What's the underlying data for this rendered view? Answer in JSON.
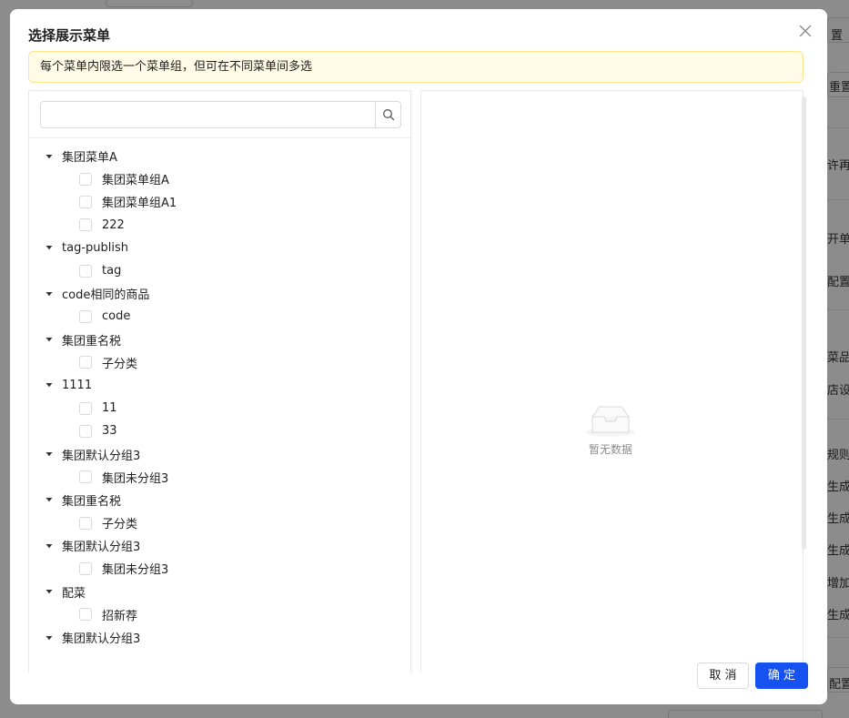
{
  "background": {
    "right_texts": [
      "置",
      "重置",
      "许再",
      "开单",
      "配置",
      "菜品",
      "店设",
      "规则",
      "生成",
      "生成",
      "生成",
      "增加",
      "生成",
      "配置"
    ],
    "bottom_texts": [
      "",
      "",
      ""
    ]
  },
  "modal": {
    "title": "选择展示菜单",
    "close_icon": "close-icon",
    "notice": "每个菜单内限选一个菜单组，但可在不同菜单间多选",
    "search": {
      "value": "",
      "placeholder": ""
    },
    "tree": [
      {
        "label": "集团菜单A",
        "children": [
          "集团菜单组A",
          "集团菜单组A1",
          "222"
        ]
      },
      {
        "label": "tag-publish",
        "children": [
          "tag"
        ]
      },
      {
        "label": "code相同的商品",
        "children": [
          "code"
        ]
      },
      {
        "label": "集团重名税",
        "children": [
          "子分类"
        ]
      },
      {
        "label": "1111",
        "children": [
          "11",
          "33"
        ]
      },
      {
        "label": "集团默认分组3",
        "children": [
          "集团未分组3"
        ]
      },
      {
        "label": "集团重名税",
        "children": [
          "子分类"
        ]
      },
      {
        "label": "集团默认分组3",
        "children": [
          "集团未分组3"
        ]
      },
      {
        "label": "配菜",
        "children": [
          "招新荐"
        ]
      },
      {
        "label": "集团默认分组3",
        "children": []
      }
    ],
    "empty_text": "暂无数据",
    "cancel_label": "取 消",
    "ok_label": "确 定"
  },
  "colors": {
    "primary": "#1552f0",
    "notice_bg": "#fffbe6",
    "notice_border": "#ffe58f"
  }
}
